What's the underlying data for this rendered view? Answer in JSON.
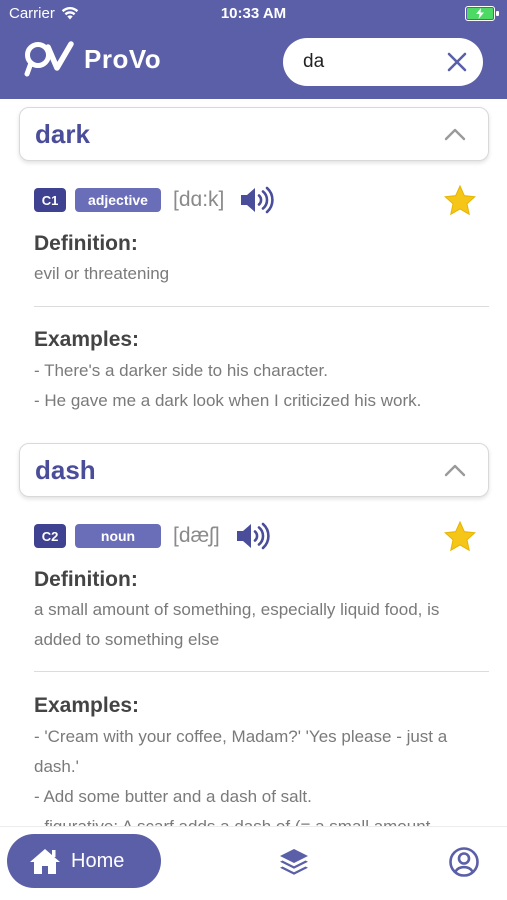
{
  "status_bar": {
    "carrier": "Carrier",
    "time": "10:33 AM"
  },
  "app": {
    "name": "ProVo"
  },
  "search": {
    "value": "da",
    "placeholder": ""
  },
  "entries": [
    {
      "word": "dark",
      "level": "C1",
      "part_of_speech": "adjective",
      "pronunciation": "[dɑ:k]",
      "definition_label": "Definition:",
      "definition": "evil or threatening",
      "examples_label": "Examples:",
      "examples": [
        "- There's a darker side to his character.",
        "- He gave me a dark look when I criticized his work."
      ]
    },
    {
      "word": "dash",
      "level": "C2",
      "part_of_speech": "noun",
      "pronunciation": "[dæʃ]",
      "definition_label": "Definition:",
      "definition": "a small amount of something, especially liquid food, is added to something else",
      "examples_label": "Examples:",
      "examples": [
        "-  'Cream with your coffee, Madam?' 'Yes please - just a dash.'",
        "- Add some butter and a dash of salt.",
        "- figurative: A scarf adds a dash of (= a small amount"
      ]
    }
  ],
  "tabbar": {
    "home_label": "Home"
  },
  "colors": {
    "brand": "#5b5fa8",
    "level_badge": "#3f4290",
    "pos_badge": "#6a6db8",
    "star": "#f5c518"
  }
}
